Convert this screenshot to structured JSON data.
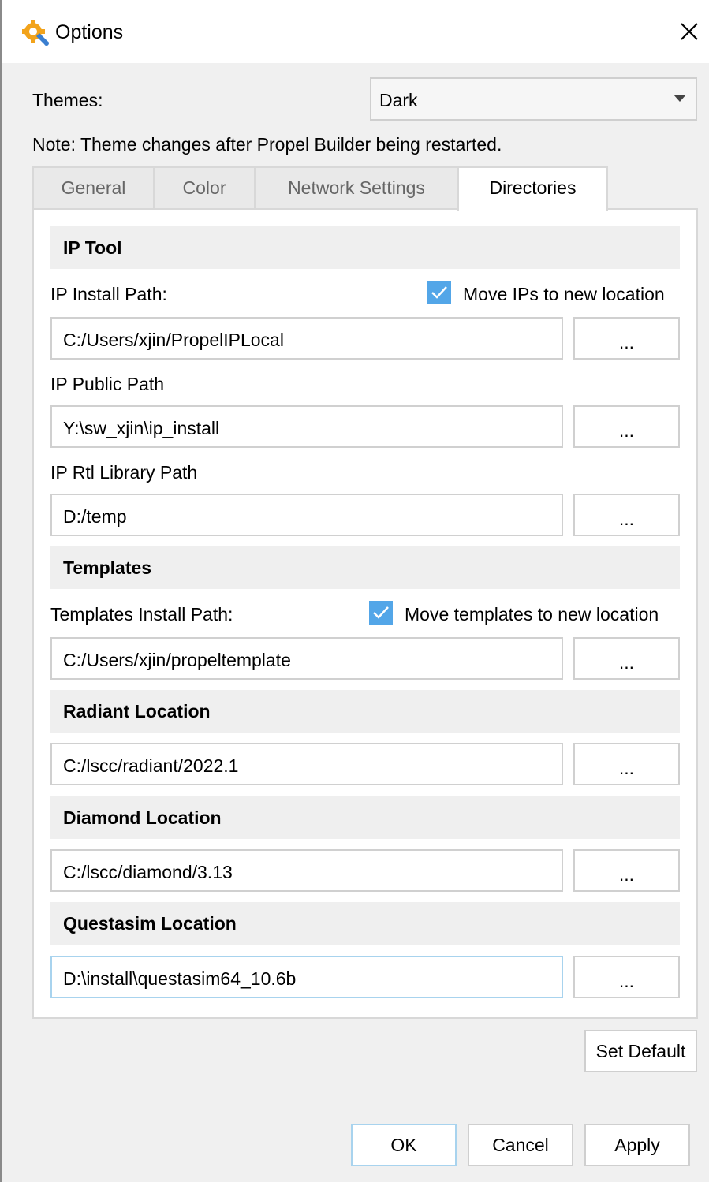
{
  "window": {
    "title": "Options"
  },
  "theme": {
    "label": "Themes:",
    "selected": "Dark",
    "note": "Note: Theme changes after Propel Builder being restarted."
  },
  "tabs": [
    {
      "label": "General"
    },
    {
      "label": "Color"
    },
    {
      "label": "Network Settings"
    },
    {
      "label": "Directories",
      "active": true
    }
  ],
  "ip_tool": {
    "header": "IP Tool",
    "install_label": "IP Install Path:",
    "move_label": "Move IPs to new location",
    "move_checked": true,
    "install_path": "C:/Users/xjin/PropelIPLocal",
    "public_label": "IP Public Path",
    "public_path": "Y:\\sw_xjin\\ip_install",
    "rtl_label": "IP Rtl Library Path",
    "rtl_path": "D:/temp"
  },
  "templates": {
    "header": "Templates",
    "install_label": "Templates Install Path:",
    "move_label": "Move templates to new location",
    "move_checked": true,
    "install_path": "C:/Users/xjin/propeltemplate"
  },
  "radiant": {
    "header": "Radiant Location",
    "path": "C:/lscc/radiant/2022.1"
  },
  "diamond": {
    "header": "Diamond Location",
    "path": "C:/lscc/diamond/3.13"
  },
  "questasim": {
    "header": "Questasim Location",
    "path": "D:\\install\\questasim64_10.6b"
  },
  "browse_label": "...",
  "buttons": {
    "set_default": "Set Default",
    "ok": "OK",
    "cancel": "Cancel",
    "apply": "Apply"
  },
  "colors": {
    "checkbox": "#53a6e8",
    "focus_border": "#a8d3ee"
  }
}
